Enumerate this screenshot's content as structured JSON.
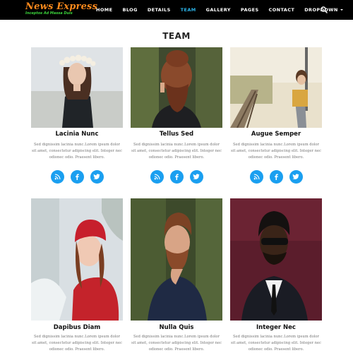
{
  "brand": {
    "title": "News Express",
    "tagline": "Inceptos Ad Massa Duis"
  },
  "nav": {
    "items": [
      {
        "label": "HOME"
      },
      {
        "label": "BLOG"
      },
      {
        "label": "DETAILS"
      },
      {
        "label": "TEAM",
        "active": true
      },
      {
        "label": "GALLERY"
      },
      {
        "label": "PAGES"
      },
      {
        "label": "CONTACT"
      },
      {
        "label": "DROPDOWN"
      }
    ],
    "search_icon": "search-icon",
    "active_color": "#2bb3e8"
  },
  "section": {
    "title": "TEAM"
  },
  "members": [
    {
      "name": "Lacinia Nunc",
      "bio_line1": "Sed dignissim lacinia nunc.Lorem ipsum dolor",
      "bio_line2": "sit amet, consectetur adipiscing elit. Integer nec",
      "bio_line3": "odionec odio. Praesent libero.",
      "photo": "woman with flower crown"
    },
    {
      "name": "Tellus Sed",
      "bio_line1": "Sed dignissim lacinia nunc.Lorem ipsum dolor",
      "bio_line2": "sit amet, consectetur adipiscing elit. Integer nec",
      "bio_line3": "odionec odio. Praesent libero.",
      "photo": "bearded man with man bun"
    },
    {
      "name": "Augue Semper",
      "bio_line1": "Sed dignissim lacinia nunc.Lorem ipsum dolor",
      "bio_line2": "sit amet, consectetur adipiscing elit. Integer nec",
      "bio_line3": "odionec odio. Praesent libero.",
      "photo": "woman on railway tracks"
    },
    {
      "name": "Dapibus Diam",
      "bio_line1": "Sed dignissim lacinia nunc.Lorem ipsum dolor",
      "bio_line2": "sit amet, consectetur adipiscing elit. Integer nec",
      "bio_line3": "odionec odio. Praesent libero.",
      "photo": "woman in red hat in snow"
    },
    {
      "name": "Nulla Quis",
      "bio_line1": "Sed dignissim lacinia nunc.Lorem ipsum dolor",
      "bio_line2": "sit amet, consectetur adipiscing elit. Integer nec",
      "bio_line3": "odionec odio. Praesent libero.",
      "photo": "bearded man in navy sweater"
    },
    {
      "name": "Integer Nec",
      "bio_line1": "Sed dignissim lacinia nunc.Lorem ipsum dolor",
      "bio_line2": "sit amet, consectetur adipiscing elit. Integer nec",
      "bio_line3": "odionec odio. Praesent libero.",
      "photo": "man in suit with sunglasses"
    }
  ],
  "social_icons": [
    "rss-icon",
    "facebook-icon",
    "twitter-icon"
  ],
  "colors": {
    "nav_bg": "#000000",
    "brand_orange": "#ff8a1c",
    "brand_green": "#3bd23b",
    "social_blue": "#1a9ff0"
  }
}
